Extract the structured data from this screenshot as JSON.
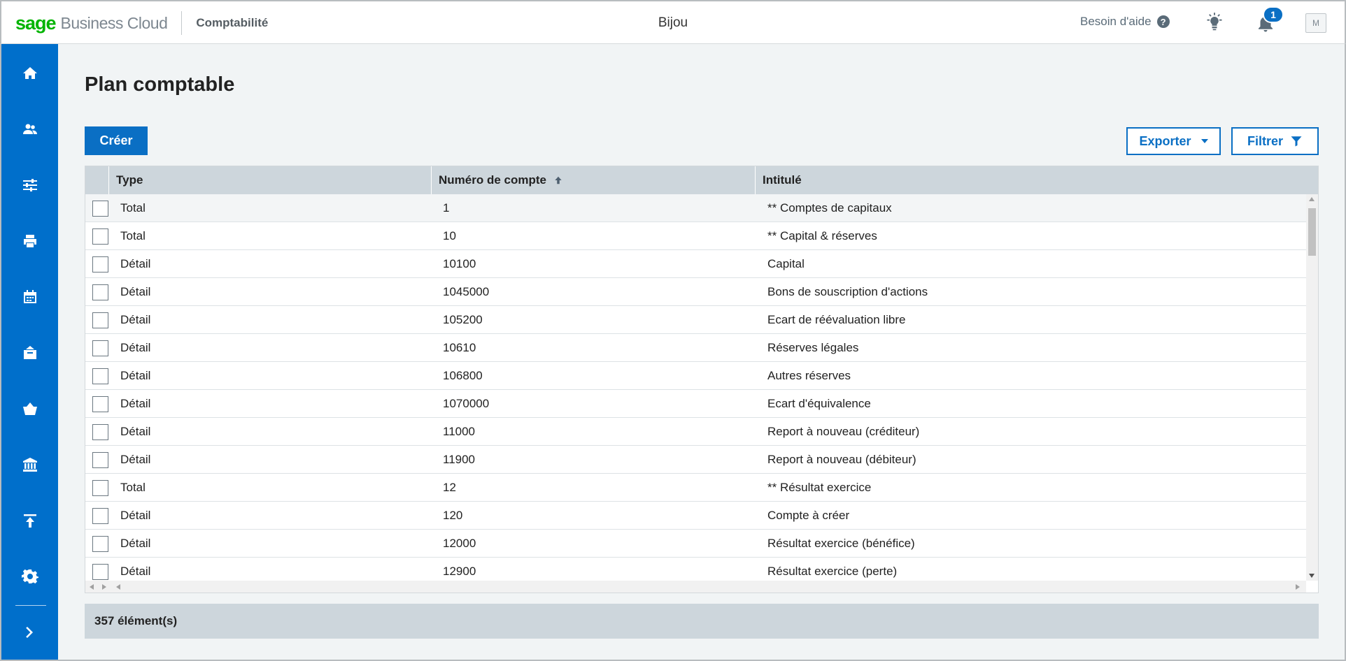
{
  "header": {
    "brand_sage": "sage",
    "brand_cloud": "Business Cloud",
    "product": "Comptabilité",
    "company": "Bijou",
    "help_label": "Besoin d'aide",
    "help_icon_glyph": "?",
    "notifications_count": "1",
    "avatar_initial": "M"
  },
  "sidebar": {
    "items": [
      {
        "icon": "home-icon"
      },
      {
        "icon": "contacts-icon"
      },
      {
        "icon": "settings-sliders-icon"
      },
      {
        "icon": "print-icon"
      },
      {
        "icon": "calendar-icon"
      },
      {
        "icon": "sales-icon"
      },
      {
        "icon": "purchases-basket-icon"
      },
      {
        "icon": "bank-icon"
      },
      {
        "icon": "upload-icon"
      },
      {
        "icon": "gear-icon"
      }
    ],
    "expand_icon": "chevron-right-icon"
  },
  "page": {
    "title": "Plan comptable",
    "create_label": "Créer",
    "export_label": "Exporter",
    "filter_label": "Filtrer"
  },
  "table": {
    "columns": [
      "Type",
      "Numéro de compte",
      "Intitulé"
    ],
    "sort": {
      "column": "Numéro de compte",
      "direction": "ascending"
    },
    "rows": [
      {
        "type": "Total",
        "number": "1",
        "label": "** Comptes de capitaux"
      },
      {
        "type": "Total",
        "number": "10",
        "label": "** Capital & réserves"
      },
      {
        "type": "Détail",
        "number": "10100",
        "label": "Capital"
      },
      {
        "type": "Détail",
        "number": "1045000",
        "label": "Bons de souscription d'actions"
      },
      {
        "type": "Détail",
        "number": "105200",
        "label": "Ecart de réévaluation libre"
      },
      {
        "type": "Détail",
        "number": "10610",
        "label": "Réserves légales"
      },
      {
        "type": "Détail",
        "number": "106800",
        "label": "Autres réserves"
      },
      {
        "type": "Détail",
        "number": "1070000",
        "label": "Ecart d'équivalence"
      },
      {
        "type": "Détail",
        "number": "11000",
        "label": "Report à nouveau (créditeur)"
      },
      {
        "type": "Détail",
        "number": "11900",
        "label": "Report à nouveau (débiteur)"
      },
      {
        "type": "Total",
        "number": "12",
        "label": "** Résultat exercice"
      },
      {
        "type": "Détail",
        "number": "120",
        "label": "Compte à créer"
      },
      {
        "type": "Détail",
        "number": "12000",
        "label": "Résultat exercice (bénéfice)"
      },
      {
        "type": "Détail",
        "number": "12900",
        "label": "Résultat exercice (perte)"
      }
    ],
    "footer_count": "357 élément(s)"
  },
  "colors": {
    "brand_green": "#00b400",
    "accent_blue": "#0a6fc4",
    "sidebar_blue": "#006fcb",
    "table_header": "#cdd6dc"
  }
}
